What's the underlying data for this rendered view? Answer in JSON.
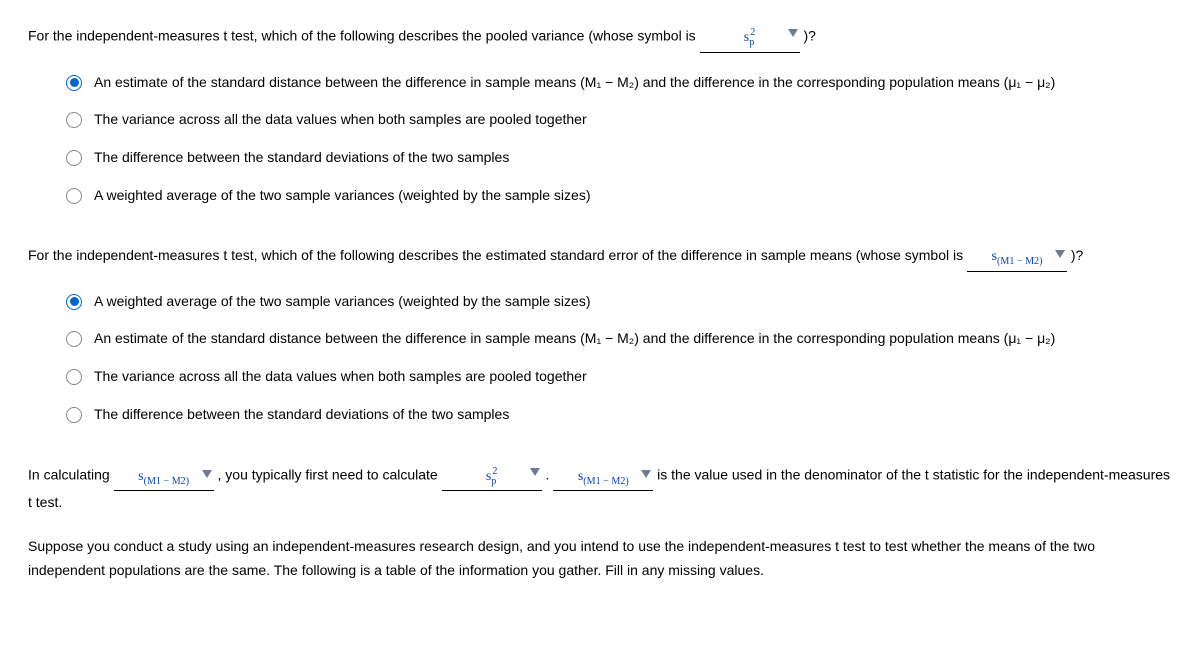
{
  "q1": {
    "text_before": "For the independent-measures t test, which of the following describes the pooled variance (whose symbol is ",
    "text_after": " )?",
    "options": [
      "An estimate of the standard distance between the difference in sample means (M₁ − M₂) and the difference in the corresponding population means (μ₁ − μ₂)",
      "The variance across all the data values when both samples are pooled together",
      "The difference between the standard deviations of the two samples",
      "A weighted average of the two sample variances (weighted by the sample sizes)"
    ],
    "selected": 0
  },
  "q2": {
    "text_before": "For the independent-measures t test, which of the following describes the estimated standard error of the difference in sample means (whose symbol is ",
    "text_after": " )?",
    "options": [
      "A weighted average of the two sample variances (weighted by the sample sizes)",
      "An estimate of the standard distance between the difference in sample means (M₁ − M₂) and the difference in the corresponding population means (μ₁ − μ₂)",
      "The variance across all the data values when both samples are pooled together",
      "The difference between the standard deviations of the two samples"
    ],
    "selected": 0
  },
  "p3": {
    "t1": "In calculating ",
    "t2": " , you typically first need to calculate ",
    "t3": " . ",
    "t4": " is the value used in the denominator of the t statistic for the independent-measures t test."
  },
  "p4": {
    "text": "Suppose you conduct a study using an independent-measures research design, and you intend to use the independent-measures t test to test whether the means of the two independent populations are the same. The following is a table of the information you gather. Fill in any missing values."
  },
  "symbols": {
    "sp2_html": "s<span class='sub'>p</span><span class='sup' style='margin-left:-4px;'>2</span>",
    "sm1m2_html": "s<span class='sub'>(M1 − M2)</span>"
  }
}
